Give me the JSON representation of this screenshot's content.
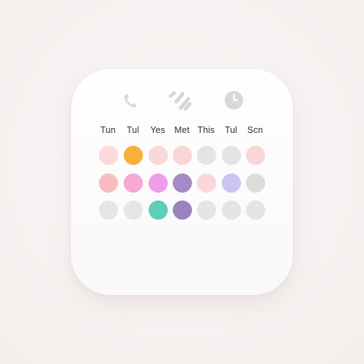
{
  "calendar": {
    "icons": [
      "phone-icon",
      "slash-marks-icon",
      "clock-icon"
    ],
    "days": [
      "Tun",
      "Tul",
      "Yes",
      "Met",
      "This",
      "Tul",
      "Scn"
    ],
    "rows": [
      [
        "#fadadb",
        "#f8b03c",
        "#fad7d8",
        "#fad5d7",
        "#e4e4e4",
        "#e4e4e4",
        "#fad5d7"
      ],
      [
        "#fbbcc0",
        "#f7a8d3",
        "#ee9ee8",
        "#a48bc7",
        "#fad7d8",
        "#c9c4f4",
        "#dcdcdc"
      ],
      [
        "#e5e5e5",
        "#e5e5e5",
        "#5bcfb8",
        "#9a84c0",
        "#e4e4e4",
        "#e4e4e4",
        "#e4e4e4"
      ]
    ]
  }
}
